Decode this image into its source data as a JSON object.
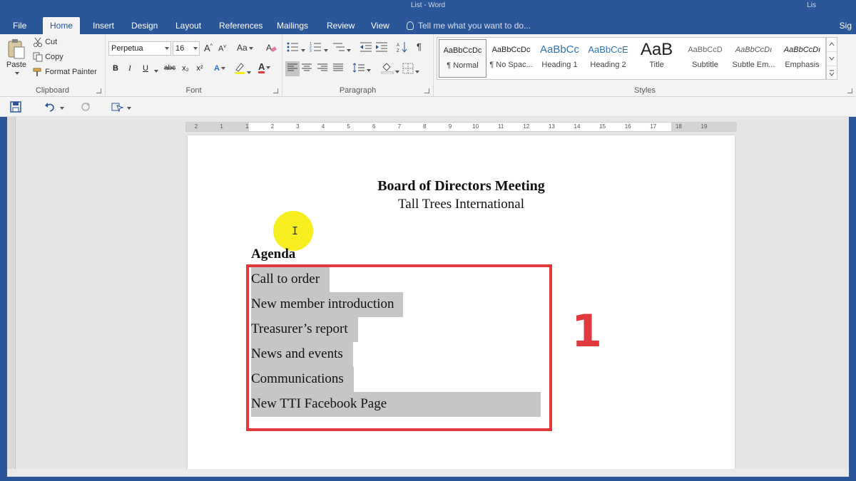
{
  "window": {
    "title": "List - Word",
    "user": "Lis",
    "tabs": [
      "File",
      "Home",
      "Insert",
      "Design",
      "Layout",
      "References",
      "Mailings",
      "Review",
      "View"
    ],
    "active_tab": "Home",
    "tell_me": "Tell me what you want to do...",
    "sign_in": "Sig"
  },
  "ribbon": {
    "clipboard": {
      "label": "Clipboard",
      "paste": "Paste",
      "cut": "Cut",
      "copy": "Copy",
      "format_painter": "Format Painter"
    },
    "font": {
      "label": "Font",
      "font_name": "Perpetua",
      "font_size": "16",
      "grow": "A",
      "shrink": "A",
      "change_case": "Aa",
      "bold": "B",
      "italic": "I",
      "underline": "U",
      "strikethrough": "abc",
      "subscript": "x₂",
      "superscript": "x²",
      "text_effects": "A",
      "font_color": "A"
    },
    "paragraph": {
      "label": "Paragraph",
      "show_marks": "¶"
    },
    "styles": {
      "label": "Styles",
      "items": [
        {
          "sample": "AaBbCcDc",
          "name": "¶ Normal"
        },
        {
          "sample": "AaBbCcDc",
          "name": "¶ No Spac..."
        },
        {
          "sample": "AaBbCc",
          "name": "Heading 1"
        },
        {
          "sample": "AaBbCcE",
          "name": "Heading 2"
        },
        {
          "sample": "AaB",
          "name": "Title"
        },
        {
          "sample": "AaBbCcD",
          "name": "Subtitle"
        },
        {
          "sample": "AaBbCcDı",
          "name": "Subtle Em..."
        },
        {
          "sample": "AaBbCcDı",
          "name": "Emphasis"
        }
      ]
    }
  },
  "ruler": {
    "labels": [
      "2",
      "1",
      "1",
      "2",
      "3",
      "4",
      "5",
      "6",
      "7",
      "8",
      "9",
      "10",
      "11",
      "12",
      "13",
      "14",
      "15",
      "16",
      "17",
      "18",
      "19"
    ]
  },
  "document": {
    "title": "Board of Directors Meeting",
    "subtitle": "Tall Trees International",
    "agenda_heading": "Agenda",
    "agenda_items": [
      "Call to order",
      "New member introduction",
      "Treasurer’s report",
      "News and events",
      "Communications",
      "New TTI Facebook Page"
    ],
    "callout_number": "1"
  },
  "colors": {
    "brand": "#2b579a",
    "highlight_box": "#e03a3e",
    "selection": "#c6c6c6",
    "cursor_spot": "#f6ee1f"
  }
}
